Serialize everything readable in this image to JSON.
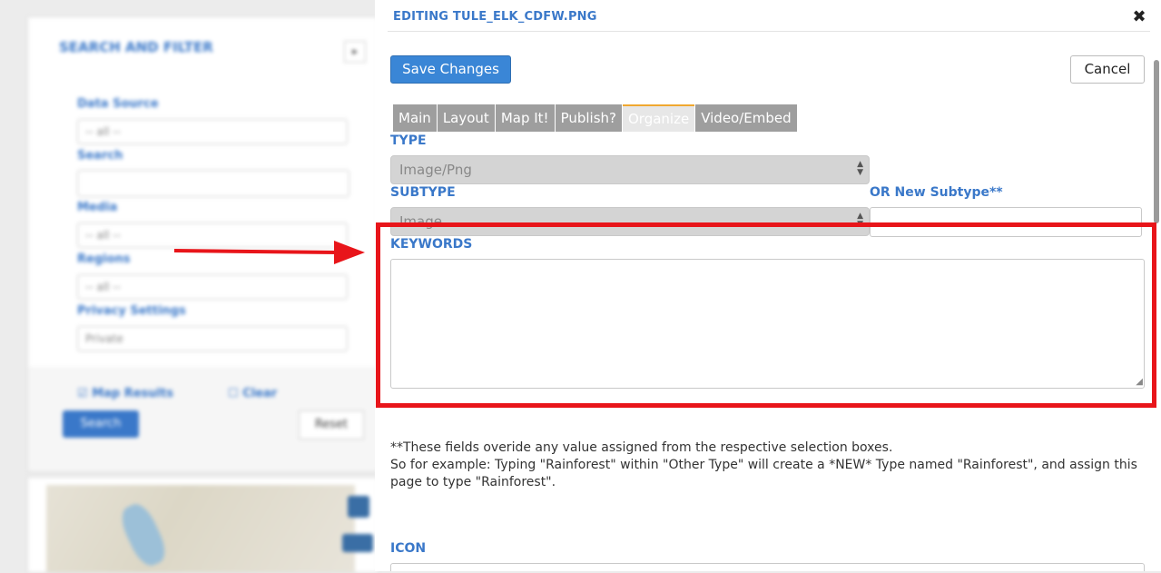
{
  "background_panel": {
    "title": "SEARCH AND FILTER",
    "toggle": "▸",
    "fields": [
      {
        "label": "Data Source",
        "value": "-- all --"
      },
      {
        "label": "Search",
        "value": ""
      },
      {
        "label": "Media",
        "value": "-- all --"
      },
      {
        "label": "Regions",
        "value": "-- all --"
      },
      {
        "label": "Privacy Settings",
        "value": "Private"
      }
    ],
    "map_results_label": "Map Results",
    "clear_label": "Clear",
    "search_button": "Search",
    "reset_button": "Reset"
  },
  "modal": {
    "title": "EDITING TULE_ELK_CDFW.PNG",
    "close_glyph": "✖",
    "save_button": "Save Changes",
    "cancel_button": "Cancel",
    "tabs": [
      {
        "label": "Main",
        "active": false
      },
      {
        "label": "Layout",
        "active": false
      },
      {
        "label": "Map It!",
        "active": false
      },
      {
        "label": "Publish?",
        "active": false
      },
      {
        "label": "Organize",
        "active": true
      },
      {
        "label": "Video/Embed",
        "active": false
      }
    ],
    "type_label": "TYPE",
    "type_value": "Image/Png",
    "subtype_label": "SUBTYPE",
    "subtype_value": "Image",
    "new_subtype_label": "OR New Subtype**",
    "keywords_label": "KEYWORDS",
    "keywords_value": "",
    "note_line1": "**These fields overide any value assigned from the respective selection boxes.",
    "note_line2": "So for example: Typing \"Rainforest\" within \"Other Type\" will create a *NEW* Type named \"Rainforest\", and assign this page to type \"Rainforest\".",
    "icon_label": "ICON"
  },
  "annotation": {
    "color": "#e8151a",
    "icon": "right-arrow-icon"
  }
}
